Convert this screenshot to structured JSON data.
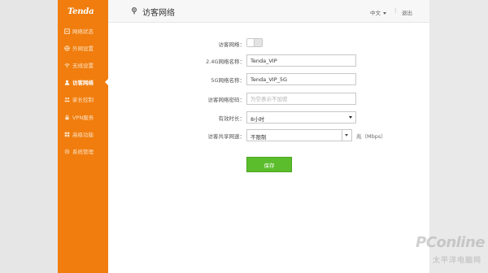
{
  "brand": {
    "logo": "Tenda"
  },
  "sidebar": {
    "items": [
      {
        "label": "网络状态",
        "icon": "network-status-icon",
        "active": false
      },
      {
        "label": "外网设置",
        "icon": "globe-icon",
        "active": false
      },
      {
        "label": "无线设置",
        "icon": "wifi-icon",
        "active": false
      },
      {
        "label": "访客网络",
        "icon": "guest-icon",
        "active": true
      },
      {
        "label": "家长控制",
        "icon": "parental-icon",
        "active": false
      },
      {
        "label": "VPN服务",
        "icon": "vpn-icon",
        "active": false
      },
      {
        "label": "高级功能",
        "icon": "advanced-icon",
        "active": false
      },
      {
        "label": "系统管理",
        "icon": "gear-icon",
        "active": false
      }
    ]
  },
  "header": {
    "title": "访客网络",
    "language": "中文",
    "separator": "|",
    "logout": "退出"
  },
  "form": {
    "guest_network_label": "访客网络：",
    "guest_network_enabled": false,
    "ssid_24_label": "2.4G网络名称：",
    "ssid_24_value": "Tenda_VIP",
    "ssid_5_label": "5G网络名称：",
    "ssid_5_value": "Tenda_VIP_5G",
    "password_label": "访客网络密码：",
    "password_placeholder": "为空表示不加密",
    "duration_label": "有效时长：",
    "duration_value": "8小时",
    "bandwidth_label": "访客共享网速：",
    "bandwidth_value": "不限制",
    "bandwidth_unit": "兆（Mbps）",
    "save_label": "保存"
  },
  "watermark": {
    "main": "PConline",
    "sub": "太平洋电脑网"
  },
  "colors": {
    "sidebar": "#f07d0d",
    "save_button": "#5bbd2c"
  }
}
